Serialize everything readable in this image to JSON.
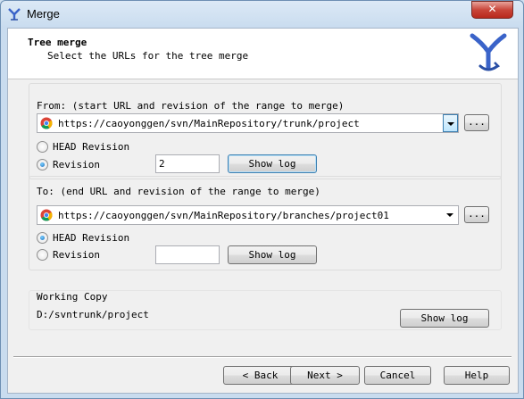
{
  "window": {
    "title": "Merge",
    "close_label": "✕"
  },
  "header": {
    "title": "Tree merge",
    "subtitle": "Select the URLs for the tree merge"
  },
  "from": {
    "label": "From: (start URL and revision of the range to merge)",
    "url": "https://caoyonggen/svn/MainRepository/trunk/project",
    "head_label": "HEAD Revision",
    "revision_label": "Revision",
    "revision_value": "2",
    "selected": "revision",
    "browse_label": "...",
    "show_log_label": "Show log"
  },
  "to": {
    "label": "To: (end URL and revision of the range to merge)",
    "url": "https://caoyonggen/svn/MainRepository/branches/project01",
    "head_label": "HEAD Revision",
    "revision_label": "Revision",
    "revision_value": "",
    "selected": "head",
    "browse_label": "...",
    "show_log_label": "Show log"
  },
  "working_copy": {
    "label": "Working Copy",
    "path": "D:/svntrunk/project",
    "show_log_label": "Show log"
  },
  "footer": {
    "back_label": "< Back",
    "next_label": "Next >",
    "cancel_label": "Cancel",
    "help_label": "Help"
  },
  "colors": {
    "accent": "#3c7fb1",
    "logo": "#3a63c9",
    "titlebar": "#c9dcef"
  },
  "icons": {
    "app": "merge-icon",
    "url": "chrome-icon",
    "logo": "tortoisesvn-merge-logo"
  }
}
